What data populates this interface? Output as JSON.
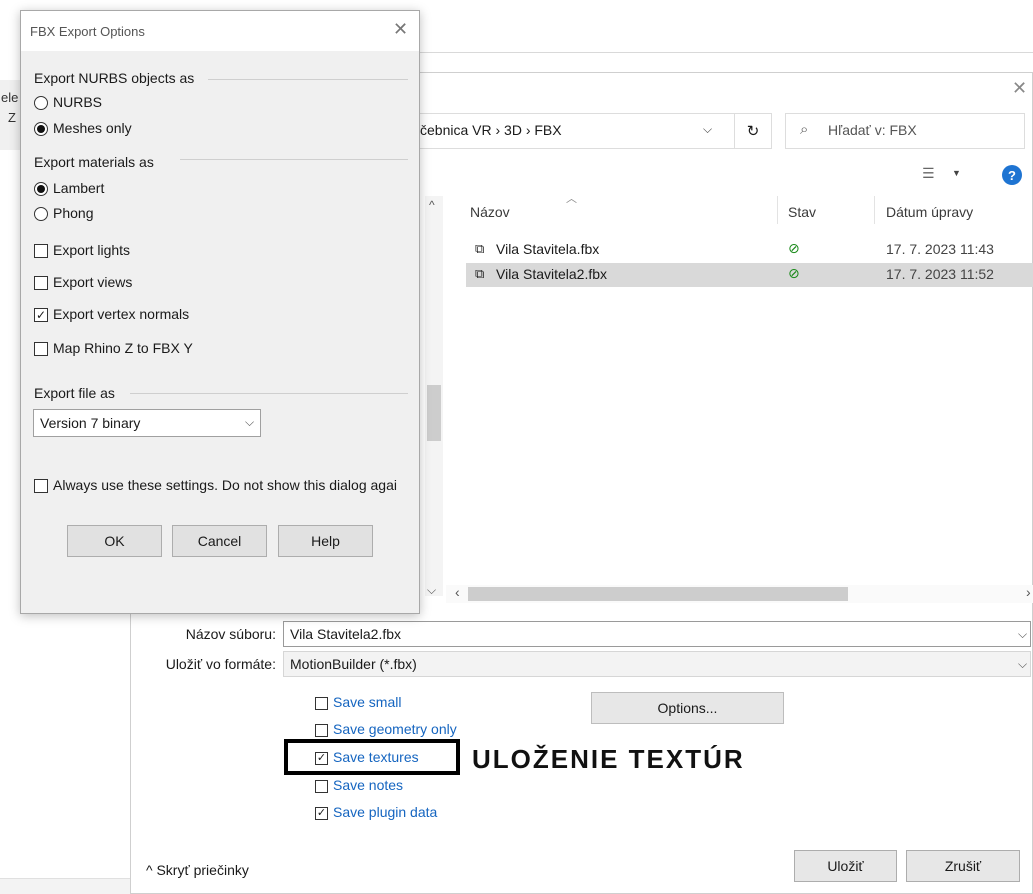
{
  "background": {
    "left_partial": "ele",
    "left_partial2": "Z"
  },
  "save_dialog": {
    "address_path": "čebnica VR  ›  3D  ›  FBX",
    "search_placeholder": "Hľadať v: FBX",
    "columns": {
      "name": "Názov",
      "status": "Stav",
      "modified": "Dátum úpravy"
    },
    "files": [
      {
        "name": "Vila Stavitela.fbx",
        "date": "17. 7. 2023 11:43",
        "selected": false
      },
      {
        "name": "Vila Stavitela2.fbx",
        "date": "17. 7. 2023 11:52",
        "selected": true
      }
    ],
    "filename_label": "Názov súboru:",
    "filename_value": "Vila Stavitela2.fbx",
    "format_label": "Uložiť vo formáte:",
    "format_value": "MotionBuilder (*.fbx)",
    "options": [
      {
        "label": "Save small",
        "checked": false
      },
      {
        "label": "Save geometry only",
        "checked": false
      },
      {
        "label": "Save textures",
        "checked": true
      },
      {
        "label": "Save notes",
        "checked": false
      },
      {
        "label": "Save plugin data",
        "checked": true
      }
    ],
    "options_button": "Options...",
    "annotation": "ULOŽENIE TEXTÚR",
    "hide_folders": "Skryť priečinky",
    "save_button": "Uložiť",
    "cancel_button": "Zrušiť"
  },
  "fbx_dialog": {
    "title": "FBX Export Options",
    "nurbs_group": "Export NURBS objects as",
    "nurbs_options": [
      {
        "label": "NURBS",
        "selected": false
      },
      {
        "label": "Meshes only",
        "selected": true
      }
    ],
    "materials_group": "Export materials as",
    "materials_options": [
      {
        "label": "Lambert",
        "selected": true
      },
      {
        "label": "Phong",
        "selected": false
      }
    ],
    "checks": [
      {
        "label": "Export lights",
        "checked": false
      },
      {
        "label": "Export views",
        "checked": false
      },
      {
        "label": "Export vertex normals",
        "checked": true
      },
      {
        "label": "Map Rhino Z to FBX Y",
        "checked": false
      }
    ],
    "file_group": "Export file as",
    "file_version": "Version 7 binary",
    "always_use": "Always use these settings. Do not show this dialog agai",
    "always_checked": false,
    "ok": "OK",
    "cancel": "Cancel",
    "help": "Help"
  },
  "colors": {
    "link_blue": "#1565c0",
    "status_green": "#1a8a1a",
    "selection_gray": "#d9d9d9"
  },
  "icons": [
    "close-icon",
    "refresh-icon",
    "search-icon",
    "view-options-icon",
    "help-icon",
    "fbx-file-icon",
    "sync-ok-icon",
    "chevron-down-icon",
    "chevron-up-icon"
  ]
}
